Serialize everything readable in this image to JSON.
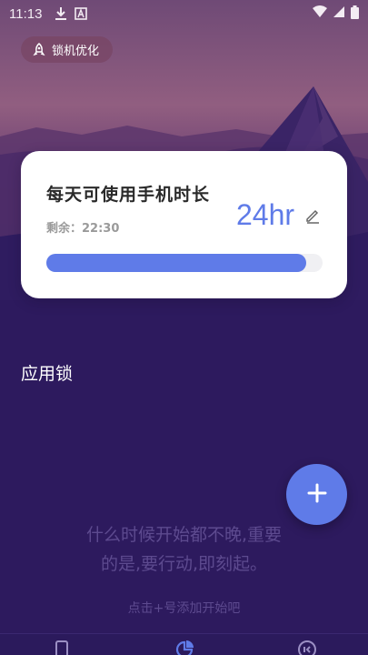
{
  "status_bar": {
    "time": "11:13",
    "icons": [
      "download-icon",
      "translate-icon",
      "wifi-icon",
      "signal-icon",
      "battery-icon"
    ]
  },
  "header": {
    "optimize_chip": {
      "label": "锁机优化",
      "icon": "rocket-icon"
    }
  },
  "usage_card": {
    "title": "每天可使用手机时长",
    "remaining_label": "剩余：",
    "remaining_value": "22:30",
    "daily_hours": "24hr",
    "progress": 0.94,
    "edit_icon": "pencil-icon"
  },
  "app_lock": {
    "section_title": "应用锁",
    "empty_quote_line1": "什么时候开始都不晚,重要",
    "empty_quote_line2": "的是,要行动,即刻起。",
    "empty_hint": "点击+号添加开始吧"
  },
  "fab": {
    "icon": "plus-icon"
  },
  "bottom_nav": {
    "items": [
      {
        "icon": "phone-icon",
        "active": false
      },
      {
        "icon": "pie-chart-icon",
        "active": true
      },
      {
        "icon": "profile-icon",
        "active": false
      }
    ]
  },
  "colors": {
    "accent": "#5f7be8",
    "background": "#2d1a5e",
    "muted_text": "#5d4a8f",
    "card": "#ffffff"
  }
}
